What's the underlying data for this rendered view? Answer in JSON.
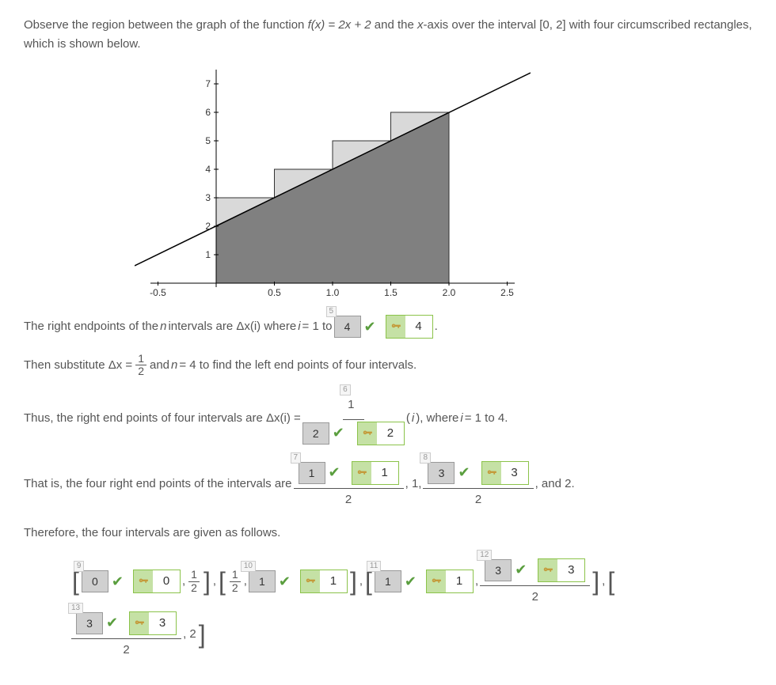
{
  "intro_pre": "Observe the region between the graph of the function ",
  "intro_fn": "f(x) = 2x + 2",
  "intro_mid": " and the ",
  "intro_x": "x",
  "intro_post": "-axis over the interval [0, 2] with four circumscribed rectangles, which is shown below.",
  "chart_data": {
    "type": "area",
    "title": "",
    "xlabel": "",
    "ylabel": "",
    "xlim": [
      -0.7,
      2.7
    ],
    "ylim": [
      0,
      7.2
    ],
    "xticks": [
      "-0.5",
      "0.5",
      "1.0",
      "1.5",
      "2.0",
      "2.5"
    ],
    "yticks": [
      "1",
      "2",
      "3",
      "4",
      "5",
      "6",
      "7"
    ],
    "line": {
      "fn": "2x+2",
      "points": [
        [
          -0.7,
          0.6
        ],
        [
          2.7,
          7.4
        ]
      ]
    },
    "rectangles": [
      {
        "x0": 0,
        "x1": 0.5,
        "h": 3
      },
      {
        "x0": 0.5,
        "x1": 1.0,
        "h": 4
      },
      {
        "x0": 1.0,
        "x1": 1.5,
        "h": 5
      },
      {
        "x0": 1.5,
        "x1": 2.0,
        "h": 6
      }
    ],
    "shaded_under_line": {
      "x0": 0,
      "x1": 2
    }
  },
  "p1_pre": "The right endpoints of the ",
  "p1_n": "n",
  "p1_mid": " intervals are  Δx(i)  where ",
  "p1_i": "i",
  "p1_eq": " = 1 to ",
  "ans5": {
    "step": "5",
    "entered": "4",
    "key": "4"
  },
  "p1_end": " .",
  "p2_pre": "Then substitute  Δx = ",
  "deltax_num": "1",
  "deltax_den": "2",
  "p2_mid": " and ",
  "p2_n": "n",
  "p2_post": " = 4  to find the left end points of four intervals.",
  "p3_pre": "Thus, the right end points of four intervals are  Δx(i) = ",
  "ans6": {
    "step": "6",
    "entered": "2",
    "key": "2",
    "num": "1"
  },
  "p3_mid1": "(",
  "p3_i": "i",
  "p3_mid2": "),  where ",
  "p3_i2": "i",
  "p3_end": " = 1 to 4.",
  "p4_pre": "That is, the four right end points of the intervals are ",
  "ans7": {
    "step": "7",
    "entered": "1",
    "key": "1",
    "den": "2"
  },
  "p4_c1": ", 1, ",
  "ans8": {
    "step": "8",
    "entered": "3",
    "key": "3",
    "den": "2"
  },
  "p4_end": ", and 2.",
  "p5": "Therefore, the four intervals are given as follows.",
  "ans9": {
    "step": "9",
    "entered": "0",
    "key": "0"
  },
  "int1_mid": ", ",
  "int1_frac_num": "1",
  "int1_frac_den": "2",
  "int_sep": ", ",
  "int2_frac_num": "1",
  "int2_frac_den": "2",
  "ans10": {
    "step": "10",
    "entered": "1",
    "key": "1"
  },
  "ans11": {
    "step": "11",
    "entered": "1",
    "key": "1"
  },
  "ans12": {
    "step": "12",
    "entered": "3",
    "key": "3",
    "den": "2"
  },
  "ans13": {
    "step": "13",
    "entered": "3",
    "key": "3",
    "den": "2"
  },
  "int5_end": ", 2",
  "lb": "[",
  "rb": "]"
}
